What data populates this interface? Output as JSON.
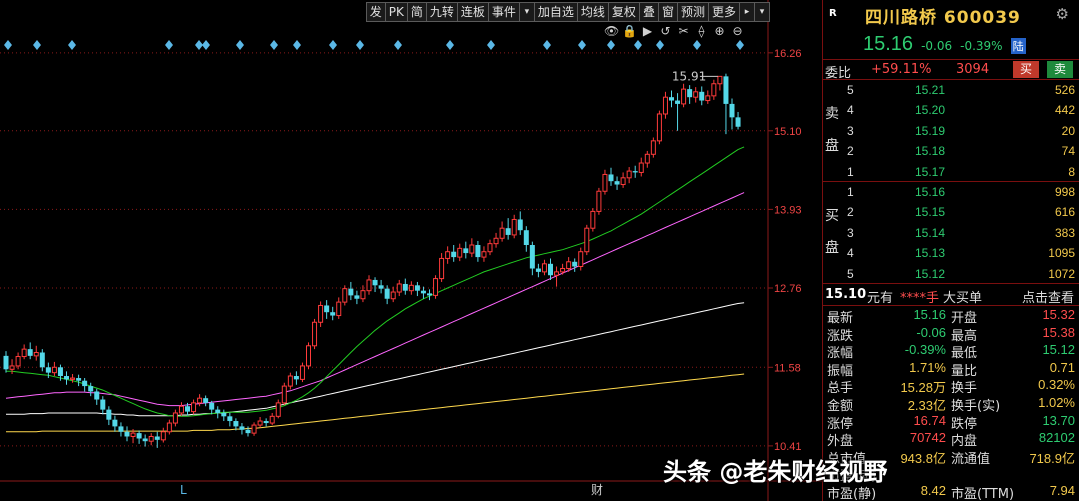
{
  "toolbar": {
    "buttons": [
      "发",
      "PK",
      "简",
      "九转",
      "连板",
      "事件",
      "加自选",
      "均线",
      "复权",
      "叠",
      "窗",
      "预测",
      "更多"
    ],
    "event_arrow": "▾",
    "more_arrow": "▸",
    "end_arrow": "▾"
  },
  "mini_icons": [
    "eye-icon",
    "lock-icon",
    "play-icon",
    "undo-icon",
    "scissors-icon",
    "magnet-icon",
    "zoom-in-icon",
    "zoom-out-icon"
  ],
  "mini_icon_glyphs": [
    "👁",
    "🔒",
    "▶",
    "↺",
    "✂",
    "⟠",
    "⊕",
    "⊖"
  ],
  "chart": {
    "y_ticks": [
      "16.26",
      "15.10",
      "13.93",
      "12.76",
      "11.58",
      "10.41"
    ],
    "high_marker": "15.91",
    "x_markers": [
      "L",
      "财"
    ],
    "colors": {
      "up": "#ff3b3b",
      "down": "#54d8e8",
      "ma1": "#ffffff",
      "ma2": "#ffd94d",
      "ma3": "#ff66ff",
      "ma4": "#22cc22",
      "grid": "#8b1a1a"
    }
  },
  "chart_data": {
    "type": "candlestick",
    "ylim": [
      10.2,
      16.6
    ],
    "candles": [
      [
        11.75,
        11.55,
        11.82,
        11.5
      ],
      [
        11.55,
        11.6,
        11.7,
        11.48
      ],
      [
        11.6,
        11.74,
        11.8,
        11.55
      ],
      [
        11.74,
        11.85,
        11.92,
        11.7
      ],
      [
        11.85,
        11.75,
        11.95,
        11.7
      ],
      [
        11.75,
        11.8,
        11.9,
        11.68
      ],
      [
        11.8,
        11.58,
        11.85,
        11.52
      ],
      [
        11.58,
        11.5,
        11.65,
        11.42
      ],
      [
        11.5,
        11.58,
        11.66,
        11.45
      ],
      [
        11.58,
        11.45,
        11.62,
        11.38
      ],
      [
        11.45,
        11.4,
        11.52,
        11.32
      ],
      [
        11.4,
        11.42,
        11.48,
        11.35
      ],
      [
        11.42,
        11.38,
        11.47,
        11.3
      ],
      [
        11.38,
        11.3,
        11.42,
        11.22
      ],
      [
        11.3,
        11.22,
        11.35,
        11.15
      ],
      [
        11.22,
        11.1,
        11.26,
        11.02
      ],
      [
        11.1,
        10.95,
        11.15,
        10.88
      ],
      [
        10.95,
        10.8,
        11.0,
        10.72
      ],
      [
        10.8,
        10.7,
        10.86,
        10.62
      ],
      [
        10.7,
        10.62,
        10.76,
        10.55
      ],
      [
        10.62,
        10.55,
        10.7,
        10.48
      ],
      [
        10.55,
        10.6,
        10.66,
        10.45
      ],
      [
        10.6,
        10.52,
        10.64,
        10.44
      ],
      [
        10.52,
        10.48,
        10.58,
        10.4
      ],
      [
        10.48,
        10.55,
        10.6,
        10.42
      ],
      [
        10.55,
        10.5,
        10.62,
        10.38
      ],
      [
        10.5,
        10.62,
        10.68,
        10.46
      ],
      [
        10.62,
        10.75,
        10.8,
        10.58
      ],
      [
        10.75,
        10.9,
        10.95,
        10.7
      ],
      [
        10.9,
        11.0,
        11.06,
        10.86
      ],
      [
        11.0,
        10.92,
        11.05,
        10.86
      ],
      [
        10.92,
        11.05,
        11.1,
        10.88
      ],
      [
        11.05,
        11.12,
        11.18,
        11.0
      ],
      [
        11.12,
        11.05,
        11.16,
        11.0
      ],
      [
        11.05,
        10.95,
        11.08,
        10.88
      ],
      [
        10.95,
        10.9,
        11.0,
        10.82
      ],
      [
        10.9,
        10.85,
        10.95,
        10.78
      ],
      [
        10.85,
        10.78,
        10.9,
        10.7
      ],
      [
        10.78,
        10.7,
        10.82,
        10.64
      ],
      [
        10.7,
        10.65,
        10.75,
        10.58
      ],
      [
        10.65,
        10.6,
        10.7,
        10.55
      ],
      [
        10.6,
        10.72,
        10.76,
        10.56
      ],
      [
        10.72,
        10.78,
        10.84,
        10.68
      ],
      [
        10.78,
        10.75,
        10.82,
        10.7
      ],
      [
        10.75,
        10.85,
        10.9,
        10.72
      ],
      [
        10.85,
        11.05,
        11.1,
        10.82
      ],
      [
        11.05,
        11.3,
        11.35,
        11.02
      ],
      [
        11.3,
        11.45,
        11.5,
        11.25
      ],
      [
        11.45,
        11.4,
        11.52,
        11.32
      ],
      [
        11.4,
        11.6,
        11.65,
        11.36
      ],
      [
        11.6,
        11.9,
        11.95,
        11.55
      ],
      [
        11.9,
        12.25,
        12.3,
        11.85
      ],
      [
        12.25,
        12.5,
        12.56,
        12.18
      ],
      [
        12.5,
        12.4,
        12.58,
        12.3
      ],
      [
        12.4,
        12.35,
        12.48,
        12.28
      ],
      [
        12.35,
        12.55,
        12.62,
        12.3
      ],
      [
        12.55,
        12.75,
        12.8,
        12.5
      ],
      [
        12.75,
        12.65,
        12.85,
        12.58
      ],
      [
        12.65,
        12.6,
        12.72,
        12.52
      ],
      [
        12.6,
        12.72,
        12.8,
        12.55
      ],
      [
        12.72,
        12.88,
        12.95,
        12.66
      ],
      [
        12.88,
        12.8,
        12.92,
        12.7
      ],
      [
        12.8,
        12.75,
        12.88,
        12.68
      ],
      [
        12.75,
        12.6,
        12.8,
        12.52
      ],
      [
        12.6,
        12.7,
        12.78,
        12.55
      ],
      [
        12.7,
        12.82,
        12.88,
        12.64
      ],
      [
        12.82,
        12.72,
        12.9,
        12.66
      ],
      [
        12.72,
        12.8,
        12.86,
        12.66
      ],
      [
        12.8,
        12.72,
        12.85,
        12.64
      ],
      [
        12.72,
        12.68,
        12.78,
        12.6
      ],
      [
        12.68,
        12.65,
        12.74,
        12.58
      ],
      [
        12.65,
        12.9,
        12.95,
        12.6
      ],
      [
        12.9,
        13.2,
        13.28,
        12.85
      ],
      [
        13.2,
        13.3,
        13.38,
        13.12
      ],
      [
        13.3,
        13.22,
        13.4,
        13.15
      ],
      [
        13.22,
        13.35,
        13.42,
        13.16
      ],
      [
        13.35,
        13.28,
        13.45,
        13.2
      ],
      [
        13.28,
        13.4,
        13.5,
        13.22
      ],
      [
        13.4,
        13.22,
        13.46,
        13.15
      ],
      [
        13.22,
        13.3,
        13.38,
        13.15
      ],
      [
        13.3,
        13.42,
        13.48,
        13.25
      ],
      [
        13.42,
        13.5,
        13.58,
        13.36
      ],
      [
        13.5,
        13.65,
        13.75,
        13.45
      ],
      [
        13.65,
        13.55,
        13.8,
        13.48
      ],
      [
        13.55,
        13.78,
        13.85,
        13.5
      ],
      [
        13.78,
        13.62,
        13.9,
        13.55
      ],
      [
        13.62,
        13.4,
        13.68,
        13.3
      ],
      [
        13.4,
        13.05,
        13.45,
        12.95
      ],
      [
        13.05,
        13.0,
        13.12,
        12.92
      ],
      [
        13.0,
        13.12,
        13.18,
        12.95
      ],
      [
        13.12,
        12.95,
        13.2,
        12.88
      ],
      [
        12.95,
        13.0,
        13.08,
        12.78
      ],
      [
        13.0,
        13.05,
        13.12,
        12.96
      ],
      [
        13.05,
        13.15,
        13.22,
        13.0
      ],
      [
        13.15,
        13.08,
        13.2,
        13.0
      ],
      [
        13.08,
        13.3,
        13.36,
        13.02
      ],
      [
        13.3,
        13.65,
        13.7,
        13.25
      ],
      [
        13.65,
        13.9,
        13.95,
        13.6
      ],
      [
        13.9,
        14.2,
        14.25,
        13.85
      ],
      [
        14.2,
        14.45,
        14.52,
        14.15
      ],
      [
        14.45,
        14.35,
        14.55,
        14.28
      ],
      [
        14.35,
        14.3,
        14.42,
        14.22
      ],
      [
        14.3,
        14.4,
        14.48,
        14.25
      ],
      [
        14.4,
        14.5,
        14.56,
        14.32
      ],
      [
        14.5,
        14.48,
        14.58,
        14.4
      ],
      [
        14.48,
        14.62,
        14.7,
        14.42
      ],
      [
        14.62,
        14.75,
        14.8,
        14.55
      ],
      [
        14.75,
        14.95,
        15.0,
        14.7
      ],
      [
        14.95,
        15.35,
        15.4,
        14.9
      ],
      [
        15.35,
        15.6,
        15.68,
        15.28
      ],
      [
        15.6,
        15.55,
        15.7,
        15.45
      ],
      [
        15.55,
        15.5,
        15.66,
        15.1
      ],
      [
        15.5,
        15.72,
        15.8,
        15.45
      ],
      [
        15.72,
        15.6,
        15.78,
        15.5
      ],
      [
        15.6,
        15.68,
        15.75,
        15.52
      ],
      [
        15.68,
        15.55,
        15.76,
        15.48
      ],
      [
        15.55,
        15.62,
        15.7,
        15.5
      ],
      [
        15.62,
        15.8,
        15.86,
        15.56
      ],
      [
        15.8,
        15.91,
        15.91,
        15.7
      ],
      [
        15.91,
        15.5,
        15.95,
        15.05
      ],
      [
        15.5,
        15.3,
        15.58,
        15.12
      ],
      [
        15.3,
        15.16,
        15.38,
        15.12
      ]
    ],
    "ma_white": [
      10.88,
      10.88,
      10.88,
      10.88,
      10.89,
      10.89,
      10.89,
      10.9,
      10.9,
      10.9,
      10.9,
      10.9,
      10.9,
      10.9,
      10.9,
      10.9,
      10.89,
      10.89,
      10.88,
      10.88,
      10.87,
      10.87,
      10.86,
      10.86,
      10.86,
      10.86,
      10.86,
      10.86,
      10.86,
      10.87,
      10.87,
      10.88,
      10.88,
      10.89,
      10.89,
      10.9,
      10.9,
      10.91,
      10.92,
      10.93,
      10.94,
      10.95,
      10.96,
      10.97,
      10.99,
      11.01,
      11.03,
      11.05,
      11.07,
      11.09,
      11.11,
      11.13,
      11.15,
      11.17,
      11.19,
      11.21,
      11.23,
      11.25,
      11.27,
      11.29,
      11.31,
      11.33,
      11.35,
      11.37,
      11.39,
      11.41,
      11.43,
      11.45,
      11.47,
      11.49,
      11.51,
      11.53,
      11.55,
      11.57,
      11.59,
      11.61,
      11.63,
      11.65,
      11.67,
      11.69,
      11.71,
      11.73,
      11.75,
      11.77,
      11.79,
      11.81,
      11.83,
      11.85,
      11.87,
      11.89,
      11.91,
      11.93,
      11.95,
      11.97,
      11.99,
      12.01,
      12.03,
      12.05,
      12.07,
      12.09,
      12.11,
      12.13,
      12.15,
      12.17,
      12.19,
      12.21,
      12.23,
      12.25,
      12.27,
      12.29,
      12.31,
      12.33,
      12.35,
      12.37,
      12.39,
      12.41,
      12.43,
      12.45,
      12.47,
      12.49,
      12.51,
      12.53,
      12.54
    ],
    "ma_yellow": [
      10.62,
      10.62,
      10.62,
      10.62,
      10.62,
      10.62,
      10.63,
      10.63,
      10.63,
      10.63,
      10.63,
      10.63,
      10.63,
      10.63,
      10.63,
      10.63,
      10.63,
      10.63,
      10.63,
      10.63,
      10.63,
      10.63,
      10.63,
      10.63,
      10.63,
      10.63,
      10.63,
      10.63,
      10.63,
      10.63,
      10.63,
      10.64,
      10.64,
      10.64,
      10.64,
      10.65,
      10.65,
      10.65,
      10.66,
      10.66,
      10.67,
      10.67,
      10.68,
      10.69,
      10.7,
      10.71,
      10.72,
      10.73,
      10.74,
      10.75,
      10.76,
      10.77,
      10.78,
      10.79,
      10.8,
      10.81,
      10.82,
      10.83,
      10.84,
      10.85,
      10.86,
      10.87,
      10.88,
      10.89,
      10.9,
      10.91,
      10.92,
      10.93,
      10.94,
      10.95,
      10.96,
      10.97,
      10.98,
      10.99,
      11.0,
      11.01,
      11.02,
      11.03,
      11.04,
      11.05,
      11.06,
      11.07,
      11.08,
      11.09,
      11.1,
      11.11,
      11.12,
      11.13,
      11.14,
      11.15,
      11.16,
      11.17,
      11.18,
      11.19,
      11.2,
      11.21,
      11.22,
      11.23,
      11.24,
      11.25,
      11.26,
      11.27,
      11.28,
      11.29,
      11.3,
      11.31,
      11.32,
      11.33,
      11.34,
      11.35,
      11.36,
      11.37,
      11.38,
      11.39,
      11.4,
      11.41,
      11.42,
      11.43,
      11.44,
      11.45,
      11.46,
      11.47,
      11.48
    ],
    "ma_magenta": [
      11.12,
      11.13,
      11.14,
      11.15,
      11.16,
      11.17,
      11.18,
      11.19,
      11.2,
      11.2,
      11.21,
      11.21,
      11.21,
      11.21,
      11.2,
      11.2,
      11.19,
      11.18,
      11.17,
      11.15,
      11.13,
      11.11,
      11.09,
      11.07,
      11.05,
      11.03,
      11.02,
      11.01,
      11.01,
      11.01,
      11.02,
      11.03,
      11.04,
      11.05,
      11.06,
      11.07,
      11.08,
      11.09,
      11.1,
      11.11,
      11.12,
      11.13,
      11.14,
      11.15,
      11.17,
      11.19,
      11.21,
      11.23,
      11.26,
      11.29,
      11.32,
      11.35,
      11.38,
      11.42,
      11.46,
      11.5,
      11.54,
      11.58,
      11.62,
      11.66,
      11.7,
      11.74,
      11.78,
      11.82,
      11.86,
      11.9,
      11.94,
      11.98,
      12.02,
      12.06,
      12.1,
      12.14,
      12.18,
      12.22,
      12.26,
      12.3,
      12.34,
      12.38,
      12.42,
      12.46,
      12.5,
      12.54,
      12.58,
      12.62,
      12.66,
      12.7,
      12.74,
      12.78,
      12.82,
      12.86,
      12.9,
      12.94,
      12.98,
      13.02,
      13.06,
      13.1,
      13.14,
      13.18,
      13.22,
      13.26,
      13.3,
      13.34,
      13.38,
      13.42,
      13.46,
      13.5,
      13.54,
      13.58,
      13.62,
      13.66,
      13.7,
      13.74,
      13.78,
      13.82,
      13.86,
      13.9,
      13.94,
      13.98,
      14.02,
      14.06,
      14.1,
      14.14,
      14.18
    ],
    "ma_green": [
      11.52,
      11.52,
      11.51,
      11.5,
      11.49,
      11.48,
      11.47,
      11.46,
      11.44,
      11.42,
      11.4,
      11.38,
      11.36,
      11.33,
      11.3,
      11.27,
      11.24,
      11.2,
      11.16,
      11.12,
      11.08,
      11.04,
      11.0,
      10.96,
      10.93,
      10.9,
      10.88,
      10.86,
      10.85,
      10.85,
      10.85,
      10.86,
      10.87,
      10.88,
      10.89,
      10.9,
      10.91,
      10.91,
      10.91,
      10.91,
      10.91,
      10.92,
      10.93,
      10.94,
      10.96,
      10.98,
      11.01,
      11.05,
      11.09,
      11.14,
      11.2,
      11.27,
      11.35,
      11.44,
      11.53,
      11.62,
      11.71,
      11.8,
      11.89,
      11.97,
      12.05,
      12.13,
      12.2,
      12.27,
      12.33,
      12.39,
      12.45,
      12.5,
      12.55,
      12.6,
      12.64,
      12.68,
      12.72,
      12.76,
      12.8,
      12.84,
      12.88,
      12.92,
      12.96,
      13.0,
      13.03,
      13.06,
      13.09,
      13.12,
      13.15,
      13.18,
      13.21,
      13.23,
      13.25,
      13.27,
      13.29,
      13.31,
      13.33,
      13.36,
      13.39,
      13.42,
      13.45,
      13.49,
      13.53,
      13.57,
      13.61,
      13.66,
      13.71,
      13.76,
      13.81,
      13.86,
      13.92,
      13.98,
      14.04,
      14.1,
      14.16,
      14.22,
      14.28,
      14.34,
      14.4,
      14.46,
      14.52,
      14.58,
      14.64,
      14.7,
      14.76,
      14.82,
      14.86
    ]
  },
  "stock": {
    "badge": "R",
    "name": "四川路桥 600039",
    "price": "15.16",
    "change": "-0.06",
    "change_pct": "-0.39%",
    "market": "陆"
  },
  "weibi": {
    "label": "委比",
    "pct": "+59.11%",
    "vol": "3094",
    "buy": "买",
    "sell": "卖"
  },
  "sell_book": {
    "side_label_1": "卖",
    "side_label_2": "盘",
    "rows": [
      {
        "level": "5",
        "price": "15.21",
        "vol": "526"
      },
      {
        "level": "4",
        "price": "15.20",
        "vol": "442"
      },
      {
        "level": "3",
        "price": "15.19",
        "vol": "20"
      },
      {
        "level": "2",
        "price": "15.18",
        "vol": "74"
      },
      {
        "level": "1",
        "price": "15.17",
        "vol": "8"
      }
    ]
  },
  "buy_book": {
    "side_label_1": "买",
    "side_label_2": "盘",
    "rows": [
      {
        "level": "1",
        "price": "15.16",
        "vol": "998"
      },
      {
        "level": "2",
        "price": "15.15",
        "vol": "616"
      },
      {
        "level": "3",
        "price": "15.14",
        "vol": "383"
      },
      {
        "level": "4",
        "price": "15.13",
        "vol": "1095"
      },
      {
        "level": "5",
        "price": "15.12",
        "vol": "1072"
      }
    ]
  },
  "tick": {
    "price": "15.10",
    "unit": "元有",
    "stars": "****手",
    "buy": "大买单",
    "view": "点击查看"
  },
  "quotes": [
    {
      "l1": "最新",
      "v1": "15.16",
      "c1": "#2ecc71",
      "l2": "开盘",
      "v2": "15.32",
      "c2": "#ff4d4d"
    },
    {
      "l1": "涨跌",
      "v1": "-0.06",
      "c1": "#2ecc71",
      "l2": "最高",
      "v2": "15.38",
      "c2": "#ff4d4d"
    },
    {
      "l1": "涨幅",
      "v1": "-0.39%",
      "c1": "#2ecc71",
      "l2": "最低",
      "v2": "15.12",
      "c2": "#2ecc71"
    },
    {
      "l1": "振幅",
      "v1": "1.71%",
      "c1": "#f2c94c",
      "l2": "量比",
      "v2": "0.71",
      "c2": "#f2c94c"
    },
    {
      "l1": "总手",
      "v1": "15.28万",
      "c1": "#f2c94c",
      "l2": "换手",
      "v2": "0.32%",
      "c2": "#f2c94c"
    },
    {
      "l1": "金额",
      "v1": "2.33亿",
      "c1": "#f2c94c",
      "l2": "换手(实)",
      "v2": "1.02%",
      "c2": "#f2c94c"
    },
    {
      "l1": "涨停",
      "v1": "16.74",
      "c1": "#ff4d4d",
      "l2": "跌停",
      "v2": "13.70",
      "c2": "#2ecc71"
    },
    {
      "l1": "外盘",
      "v1": "70742",
      "c1": "#ff4d4d",
      "l2": "内盘",
      "v2": "82102",
      "c2": "#2ecc71"
    },
    {
      "l1": "总市值",
      "v1": "943.8亿",
      "c1": "#f2c94c",
      "l2": "流通值",
      "v2": "718.9亿",
      "c2": "#f2c94c"
    },
    {
      "l1": "市盈(动)",
      "v1": "",
      "c1": "#f2c94c",
      "l2": "",
      "v2": "",
      "c2": "#f2c94c"
    },
    {
      "l1": "市盈(静)",
      "v1": "8.42",
      "c1": "#f2c94c",
      "l2": "市盈(TTM)",
      "v2": "7.94",
      "c2": "#f2c94c"
    }
  ],
  "watermark": "头条 @老朱财经视野"
}
